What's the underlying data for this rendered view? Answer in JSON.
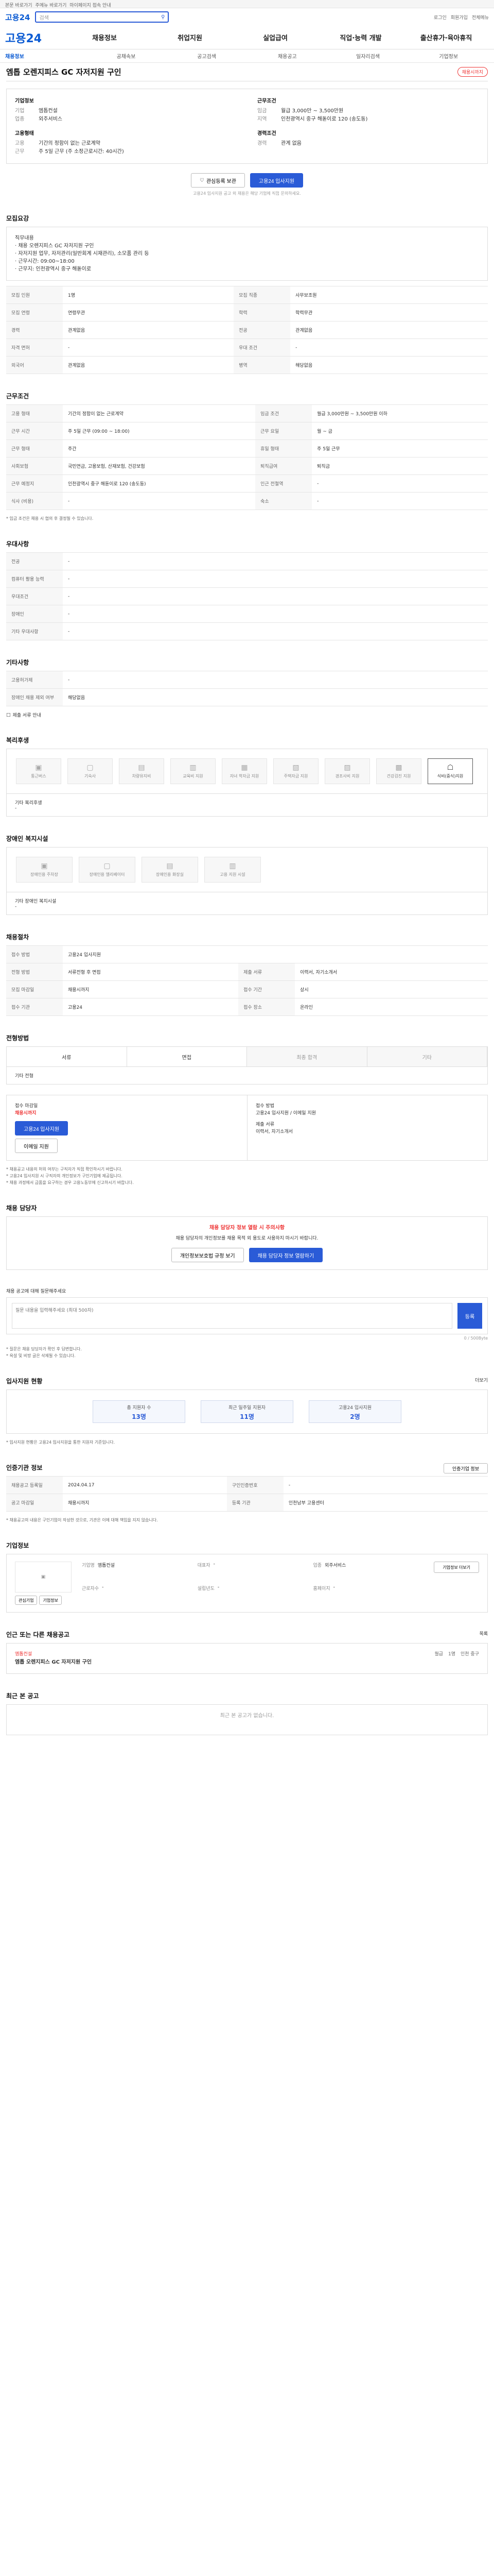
{
  "topbar": {
    "text1": "본문 바로가기",
    "text2": "주메뉴 바로가기",
    "notice": "마이페이지 접속 안내"
  },
  "header": {
    "logo": "고용24",
    "search_placeholder": "검색",
    "login": "로그인",
    "join": "회원가입",
    "sitemap": "전체메뉴"
  },
  "gnb": {
    "logo": "고용24",
    "items": [
      "채용정보",
      "취업지원",
      "실업급여",
      "직업·능력 개발",
      "출산휴가·육아휴직"
    ]
  },
  "lnb": {
    "items": [
      "채용정보",
      "공채속보",
      "공고검색",
      "채용공고",
      "일자리검색",
      "기업정보"
    ]
  },
  "job": {
    "title": "엠톱 오렌지피스 GC 자저지원 구인",
    "badge": "채용시까지",
    "company_label": "기업정보",
    "company_rows": [
      {
        "k": "기업",
        "v": "엠톱컨설"
      },
      {
        "k": "업종",
        "v": "외주서비스"
      }
    ],
    "cond_label": "근무조건",
    "cond_rows": [
      {
        "k": "임금",
        "v": "월급 3,000만 ~ 3,500만원"
      },
      {
        "k": "지역",
        "v": "인천광역시 중구 해돋이로 120 (송도동)"
      }
    ],
    "form_label": "고용형태",
    "form_rows": [
      {
        "k": "고용",
        "v": "기간의 정함이 없는 근로계약"
      },
      {
        "k": "근무",
        "v": "주 5일 근무 (주 소정근로시간: 40시간)"
      }
    ],
    "career_label": "경력조건",
    "career_rows": [
      {
        "k": "경력",
        "v": "관계 없음"
      }
    ]
  },
  "buttons": {
    "scrap": "관심등록 보관",
    "apply": "고용24 입사지원",
    "note": "고용24 입사지원 공고 외 채용은 해당 기업에 직접 문의하세요."
  },
  "sections": {
    "recruit": "모집요강",
    "recruit_text": "직무내용\n· 채용 오렌지피스 GC 자저지원 구인\n· 자저지원 업무, 자저관리(일반회계 시재관리), 소모품 관리 등\n· 근무시간: 09:00~18:00\n· 근무지: 인천광역시 중구 해돋이로",
    "recruit_table": [
      {
        "h": "모집 인원",
        "v": "1명",
        "h2": "모집 직종",
        "v2": "사무보조원"
      },
      {
        "h": "모집 연령",
        "v": "연령무관",
        "h2": "학력",
        "v2": "학력무관"
      },
      {
        "h": "경력",
        "v": "관계없음",
        "h2": "전공",
        "v2": "관계없음"
      },
      {
        "h": "자격 면허",
        "v": "-",
        "h2": "우대 조건",
        "v2": "-"
      },
      {
        "h": "외국어",
        "v": "관계없음",
        "h2": "병역",
        "v2": "해당없음"
      }
    ],
    "work": "근무조건",
    "work_table": [
      {
        "h": "고용 형태",
        "v": "기간의 정함이 없는 근로계약",
        "h2": "임금 조건",
        "v2": "월급 3,000만원 ~ 3,500만원 이하"
      },
      {
        "h": "근무 시간",
        "v": "주 5일 근무 (09:00 ~ 18:00)",
        "h2": "근무 요일",
        "v2": "월 ~ 금"
      },
      {
        "h": "근무 형태",
        "v": "주간",
        "h2": "휴일 형태",
        "v2": "주 5일 근무"
      },
      {
        "h": "사회보험",
        "v": "국민연금, 고용보험, 산재보험, 건강보험",
        "h2": "퇴직급여",
        "v2": "퇴직금"
      },
      {
        "h": "근무 예정지",
        "v": "인천광역시 중구 해돋이로 120 (송도동)",
        "h2": "인근 전철역",
        "v2": "-"
      },
      {
        "h": "식사 (비용)",
        "v": "-",
        "h2": "숙소",
        "v2": "-"
      }
    ],
    "work_note": "* 임금 조건은 채용 시 협의 후 결정될 수 있습니다.",
    "pref": "우대사항",
    "pref_table": [
      {
        "h": "전공",
        "v": "-"
      },
      {
        "h": "컴퓨터 활용 능력",
        "v": "-"
      },
      {
        "h": "우대조건",
        "v": "-"
      },
      {
        "h": "장애인",
        "v": "-"
      },
      {
        "h": "기타 우대사항",
        "v": "-"
      }
    ],
    "etc": "기타사항",
    "etc_table": [
      {
        "h": "고용허가제",
        "v": "-"
      },
      {
        "h": "장애인 채용 제외 여부",
        "v": "해당없음"
      }
    ],
    "etc_doc": "제출 서류 안내",
    "welfare": "복리후생",
    "welfare_items": [
      "통근버스",
      "기숙사",
      "차량유지비",
      "교육비 지원",
      "자녀 학자금 지원",
      "주택자금 지원",
      "경조사비 지원",
      "건강검진 지원",
      "식비(중식)지원"
    ],
    "welfare_note": "기타 복리후생",
    "welfare_note_value": "-",
    "disabled": "장애인 복지시설",
    "disabled_items": [
      "장애인용 주차장",
      "장애인용 엘리베이터",
      "장애인용 화장실",
      "고용 지원 시설"
    ],
    "disabled_note": "기타 장애인 복지시설",
    "disabled_note_value": "-",
    "process": "채용절차",
    "process_table": [
      {
        "h": "접수 방법",
        "v": "고용24 입사지원"
      },
      {
        "h": "전형 방법",
        "v": "서류전형 후 면접",
        "h2": "제출 서류",
        "v2": "이력서, 자기소개서"
      },
      {
        "h": "모집 마감일",
        "v": "채용시까지",
        "h2": "접수 기간",
        "v2": "상시"
      },
      {
        "h": "접수 기관",
        "v": "고용24",
        "h2": "접수 장소",
        "v2": "온라인"
      }
    ],
    "steps_title": "전형방법",
    "steps": [
      "서류",
      "면접",
      "최종 합격",
      "기타"
    ],
    "steps_note": "기타 전형",
    "apply_box_title": "접수 마감일",
    "apply_deadline": "채용시까지",
    "apply_btn": "고용24 입사지원",
    "apply_btn2": "이메일 지원",
    "apply_info_title": "접수 방법",
    "apply_info": "고용24 입사지원 / 이메일 지원",
    "docs_title": "제출 서류",
    "docs": "이력서, 자기소개서",
    "notices": [
      "* 채용공고 내용의 허위 여부는 구직자가 직접 확인하시기 바랍니다.",
      "* 고용24 입사지원 시 구직자의 개인정보가 구인기업에 제공됩니다.",
      "* 채용 과정에서 금품을 요구하는 경우 고용노동부에 신고하시기 바랍니다."
    ],
    "manager": "채용 담당자",
    "manager_notice": "채용 담당자 정보 열람 시 주의사항",
    "manager_text": "채용 담당자의 개인정보를 채용 목적 외 용도로 사용하지 마시기 바랍니다.",
    "manager_btn1": "개인정보보호법 규정 보기",
    "manager_btn2": "채용 담당자 정보 열람하기",
    "comment_title": "채용 공고에 대해 질문해주세요",
    "comment_placeholder": "질문 내용을 입력해주세요 (최대 500자)",
    "comment_count": "0 / 500Byte",
    "comment_btn": "등록",
    "comment_notes": [
      "* 질문은 채용 담당자가 확인 후 답변합니다.",
      "* 욕설 및 비방 글은 삭제될 수 있습니다."
    ],
    "stat": "입사지원 현황",
    "stat_more": "더보기",
    "stat_cards": [
      {
        "k": "총 지원자 수",
        "v": "13명"
      },
      {
        "k": "최근 일주일 지원자",
        "v": "11명"
      },
      {
        "k": "고용24 입사지원",
        "v": "2명"
      }
    ],
    "stat_note": "* 입사지원 현황은 고용24 입사지원을 통한 지원자 기준입니다.",
    "info": "인증기관 정보",
    "info_btn": "인증기업 정보",
    "info_table": [
      {
        "h": "채용공고 등록일",
        "v": "2024.04.17",
        "h2": "구인인증번호",
        "v2": "-"
      },
      {
        "h": "공고 마감일",
        "v": "채용시까지",
        "h2": "등록 기관",
        "v2": "인천남부 고용센터"
      }
    ],
    "info_notes": [
      "* 채용공고의 내용은 구인기업이 작성한 것으로, 기관은 이에 대해 책임을 지지 않습니다."
    ],
    "cinfo": "기업정보",
    "cinfo_btns": [
      "관심기업",
      "기업정보"
    ],
    "cinfo_rows": [
      {
        "k": "기업명",
        "v": "엠톱컨설"
      },
      {
        "k": "대표자",
        "v": "-"
      },
      {
        "k": "업종",
        "v": "외주서비스"
      },
      {
        "k": "근로자수",
        "v": "-"
      },
      {
        "k": "설립년도",
        "v": "-"
      },
      {
        "k": "홈페이지",
        "v": "-"
      }
    ],
    "cinfo_more": "기업정보 더보기",
    "similar": "인근 또는 다른 채용공고",
    "similar_more": "목록",
    "similar_company": "엠톱컨설",
    "similar_title": "엠톱 오렌지피스 GC 자저지원 구인",
    "similar_tags": [
      "월급",
      "1명",
      "인천 중구"
    ],
    "recent": "최근 본 공고",
    "recent_empty": "최근 본 공고가 없습니다."
  }
}
